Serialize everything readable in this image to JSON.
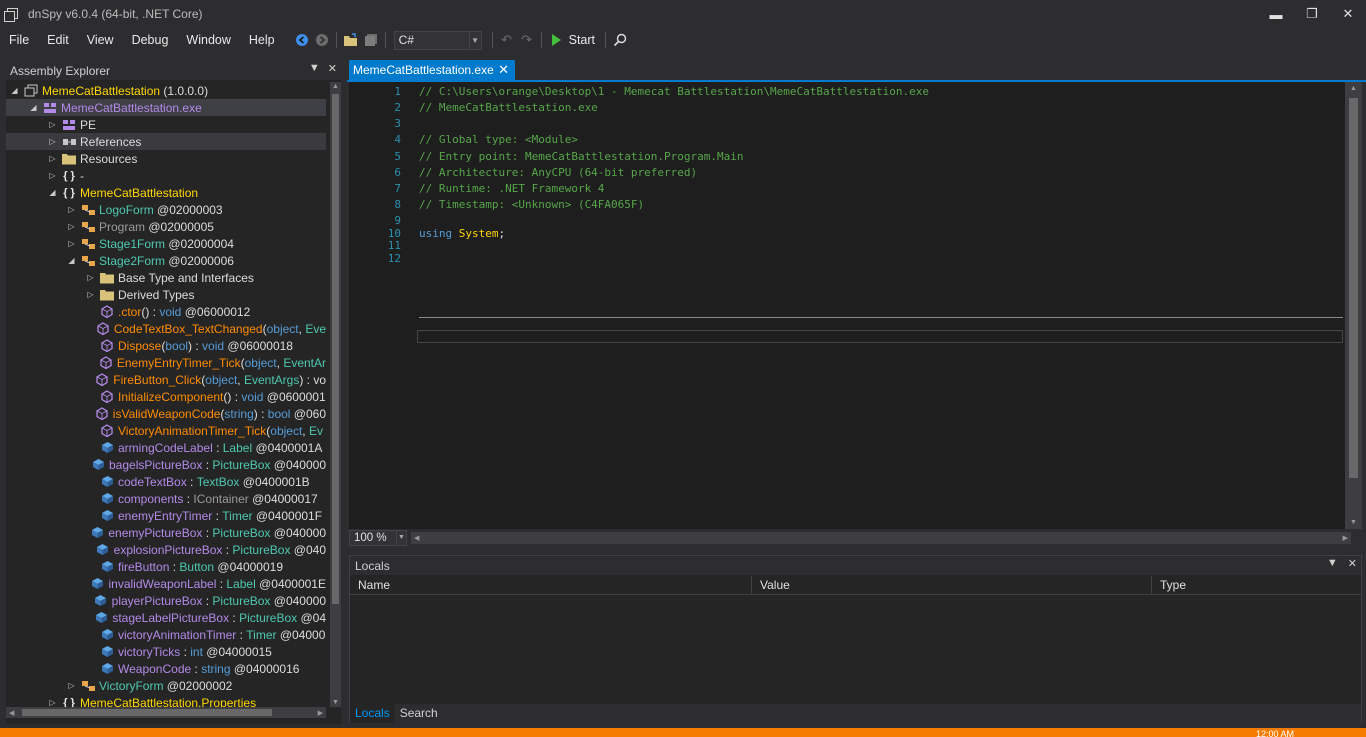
{
  "window": {
    "title": "dnSpy v6.0.4 (64-bit, .NET Core)",
    "minimize": "▬",
    "maximize": "❐",
    "close": "✕"
  },
  "menu": [
    "File",
    "Edit",
    "View",
    "Debug",
    "Window",
    "Help"
  ],
  "toolbar": {
    "language": "C#",
    "start_label": "Start"
  },
  "explorer": {
    "title": "Assembly Explorer",
    "nodes": [
      {
        "indent": 0,
        "exp": "◢",
        "icon": "asm",
        "parts": [
          {
            "t": "MemeCatBattlestation",
            "c": "c-yellow"
          },
          {
            "t": " (1.0.0.0)",
            "c": "c-white"
          }
        ]
      },
      {
        "indent": 1,
        "exp": "◢",
        "icon": "mod",
        "parts": [
          {
            "t": "MemeCatBattlestation.exe",
            "c": "c-purple"
          }
        ],
        "style": "sel"
      },
      {
        "indent": 2,
        "exp": "▷",
        "icon": "mod",
        "parts": [
          {
            "t": "PE",
            "c": "c-white"
          }
        ]
      },
      {
        "indent": 2,
        "exp": "▷",
        "icon": "ref",
        "parts": [
          {
            "t": "References",
            "c": "c-white"
          }
        ],
        "style": "hl"
      },
      {
        "indent": 2,
        "exp": "▷",
        "icon": "folder",
        "parts": [
          {
            "t": "Resources",
            "c": "c-white"
          }
        ]
      },
      {
        "indent": 2,
        "exp": "▷",
        "icon": "ns",
        "parts": [
          {
            "t": "-",
            "c": "c-white"
          }
        ]
      },
      {
        "indent": 2,
        "exp": "◢",
        "icon": "ns",
        "parts": [
          {
            "t": "MemeCatBattlestation",
            "c": "c-yellow"
          }
        ]
      },
      {
        "indent": 3,
        "exp": "▷",
        "icon": "cls",
        "parts": [
          {
            "t": "LogoForm",
            "c": "c-cyan"
          },
          {
            "t": " @02000003",
            "c": "c-white"
          }
        ]
      },
      {
        "indent": 3,
        "exp": "▷",
        "icon": "cls",
        "parts": [
          {
            "t": "Program",
            "c": "c-gray"
          },
          {
            "t": " @02000005",
            "c": "c-white"
          }
        ]
      },
      {
        "indent": 3,
        "exp": "▷",
        "icon": "cls",
        "parts": [
          {
            "t": "Stage1Form",
            "c": "c-cyan"
          },
          {
            "t": " @02000004",
            "c": "c-white"
          }
        ]
      },
      {
        "indent": 3,
        "exp": "◢",
        "icon": "cls",
        "parts": [
          {
            "t": "Stage2Form",
            "c": "c-cyan"
          },
          {
            "t": " @02000006",
            "c": "c-white"
          }
        ]
      },
      {
        "indent": 4,
        "exp": "▷",
        "icon": "folder",
        "parts": [
          {
            "t": "Base Type and Interfaces",
            "c": "c-white"
          }
        ]
      },
      {
        "indent": 4,
        "exp": "▷",
        "icon": "folder",
        "parts": [
          {
            "t": "Derived Types",
            "c": "c-white"
          }
        ]
      },
      {
        "indent": 4,
        "exp": "",
        "icon": "meth",
        "parts": [
          {
            "t": ".ctor",
            "c": "c-orange"
          },
          {
            "t": "() : ",
            "c": "c-white"
          },
          {
            "t": "void",
            "c": "c-blue"
          },
          {
            "t": " @06000012",
            "c": "c-white"
          }
        ]
      },
      {
        "indent": 4,
        "exp": "",
        "icon": "meth",
        "parts": [
          {
            "t": "CodeTextBox_TextChanged",
            "c": "c-orange"
          },
          {
            "t": "(",
            "c": "c-white"
          },
          {
            "t": "object",
            "c": "c-blue"
          },
          {
            "t": ", ",
            "c": "c-white"
          },
          {
            "t": "Eve",
            "c": "c-green"
          }
        ]
      },
      {
        "indent": 4,
        "exp": "",
        "icon": "meth",
        "parts": [
          {
            "t": "Dispose",
            "c": "c-orange"
          },
          {
            "t": "(",
            "c": "c-white"
          },
          {
            "t": "bool",
            "c": "c-blue"
          },
          {
            "t": ") : ",
            "c": "c-white"
          },
          {
            "t": "void",
            "c": "c-blue"
          },
          {
            "t": " @06000018",
            "c": "c-white"
          }
        ]
      },
      {
        "indent": 4,
        "exp": "",
        "icon": "meth",
        "parts": [
          {
            "t": "EnemyEntryTimer_Tick",
            "c": "c-orange"
          },
          {
            "t": "(",
            "c": "c-white"
          },
          {
            "t": "object",
            "c": "c-blue"
          },
          {
            "t": ", ",
            "c": "c-white"
          },
          {
            "t": "EventAr",
            "c": "c-green"
          }
        ]
      },
      {
        "indent": 4,
        "exp": "",
        "icon": "meth",
        "parts": [
          {
            "t": "FireButton_Click",
            "c": "c-orange"
          },
          {
            "t": "(",
            "c": "c-white"
          },
          {
            "t": "object",
            "c": "c-blue"
          },
          {
            "t": ", ",
            "c": "c-white"
          },
          {
            "t": "EventArgs",
            "c": "c-green"
          },
          {
            "t": ") : vo",
            "c": "c-white"
          }
        ]
      },
      {
        "indent": 4,
        "exp": "",
        "icon": "meth",
        "parts": [
          {
            "t": "InitializeComponent",
            "c": "c-orange"
          },
          {
            "t": "() : ",
            "c": "c-white"
          },
          {
            "t": "void",
            "c": "c-blue"
          },
          {
            "t": " @0600001",
            "c": "c-white"
          }
        ]
      },
      {
        "indent": 4,
        "exp": "",
        "icon": "meth",
        "parts": [
          {
            "t": "isValidWeaponCode",
            "c": "c-orange"
          },
          {
            "t": "(",
            "c": "c-white"
          },
          {
            "t": "string",
            "c": "c-blue"
          },
          {
            "t": ") : ",
            "c": "c-white"
          },
          {
            "t": "bool",
            "c": "c-blue"
          },
          {
            "t": " @060",
            "c": "c-white"
          }
        ]
      },
      {
        "indent": 4,
        "exp": "",
        "icon": "meth",
        "parts": [
          {
            "t": "VictoryAnimationTimer_Tick",
            "c": "c-orange"
          },
          {
            "t": "(",
            "c": "c-white"
          },
          {
            "t": "object",
            "c": "c-blue"
          },
          {
            "t": ", ",
            "c": "c-white"
          },
          {
            "t": "Ev",
            "c": "c-green"
          }
        ]
      },
      {
        "indent": 4,
        "exp": "",
        "icon": "fld",
        "parts": [
          {
            "t": "armingCodeLabel",
            "c": "c-purple"
          },
          {
            "t": " : ",
            "c": "c-white"
          },
          {
            "t": "Label",
            "c": "c-green"
          },
          {
            "t": " @0400001A",
            "c": "c-white"
          }
        ]
      },
      {
        "indent": 4,
        "exp": "",
        "icon": "fld",
        "parts": [
          {
            "t": "bagelsPictureBox",
            "c": "c-purple"
          },
          {
            "t": " : ",
            "c": "c-white"
          },
          {
            "t": "PictureBox",
            "c": "c-green"
          },
          {
            "t": " @040000",
            "c": "c-white"
          }
        ]
      },
      {
        "indent": 4,
        "exp": "",
        "icon": "fld",
        "parts": [
          {
            "t": "codeTextBox",
            "c": "c-purple"
          },
          {
            "t": " : ",
            "c": "c-white"
          },
          {
            "t": "TextBox",
            "c": "c-green"
          },
          {
            "t": " @0400001B",
            "c": "c-white"
          }
        ]
      },
      {
        "indent": 4,
        "exp": "",
        "icon": "fld",
        "parts": [
          {
            "t": "components",
            "c": "c-purple"
          },
          {
            "t": " : ",
            "c": "c-white"
          },
          {
            "t": "IContainer",
            "c": "c-gray"
          },
          {
            "t": " @04000017",
            "c": "c-white"
          }
        ]
      },
      {
        "indent": 4,
        "exp": "",
        "icon": "fld",
        "parts": [
          {
            "t": "enemyEntryTimer",
            "c": "c-purple"
          },
          {
            "t": " : ",
            "c": "c-white"
          },
          {
            "t": "Timer",
            "c": "c-green"
          },
          {
            "t": " @0400001F",
            "c": "c-white"
          }
        ]
      },
      {
        "indent": 4,
        "exp": "",
        "icon": "fld",
        "parts": [
          {
            "t": "enemyPictureBox",
            "c": "c-purple"
          },
          {
            "t": " : ",
            "c": "c-white"
          },
          {
            "t": "PictureBox",
            "c": "c-green"
          },
          {
            "t": " @040000",
            "c": "c-white"
          }
        ]
      },
      {
        "indent": 4,
        "exp": "",
        "icon": "fld",
        "parts": [
          {
            "t": "explosionPictureBox",
            "c": "c-purple"
          },
          {
            "t": " : ",
            "c": "c-white"
          },
          {
            "t": "PictureBox",
            "c": "c-green"
          },
          {
            "t": " @040",
            "c": "c-white"
          }
        ]
      },
      {
        "indent": 4,
        "exp": "",
        "icon": "fld",
        "parts": [
          {
            "t": "fireButton",
            "c": "c-purple"
          },
          {
            "t": " : ",
            "c": "c-white"
          },
          {
            "t": "Button",
            "c": "c-green"
          },
          {
            "t": " @04000019",
            "c": "c-white"
          }
        ]
      },
      {
        "indent": 4,
        "exp": "",
        "icon": "fld",
        "parts": [
          {
            "t": "invalidWeaponLabel",
            "c": "c-purple"
          },
          {
            "t": " : ",
            "c": "c-white"
          },
          {
            "t": "Label",
            "c": "c-green"
          },
          {
            "t": " @0400001E",
            "c": "c-white"
          }
        ]
      },
      {
        "indent": 4,
        "exp": "",
        "icon": "fld",
        "parts": [
          {
            "t": "playerPictureBox",
            "c": "c-purple"
          },
          {
            "t": " : ",
            "c": "c-white"
          },
          {
            "t": "PictureBox",
            "c": "c-green"
          },
          {
            "t": " @040000",
            "c": "c-white"
          }
        ]
      },
      {
        "indent": 4,
        "exp": "",
        "icon": "fld",
        "parts": [
          {
            "t": "stageLabelPictureBox",
            "c": "c-purple"
          },
          {
            "t": " : ",
            "c": "c-white"
          },
          {
            "t": "PictureBox",
            "c": "c-green"
          },
          {
            "t": " @04",
            "c": "c-white"
          }
        ]
      },
      {
        "indent": 4,
        "exp": "",
        "icon": "fld",
        "parts": [
          {
            "t": "victoryAnimationTimer",
            "c": "c-purple"
          },
          {
            "t": " : ",
            "c": "c-white"
          },
          {
            "t": "Timer",
            "c": "c-green"
          },
          {
            "t": " @04000",
            "c": "c-white"
          }
        ]
      },
      {
        "indent": 4,
        "exp": "",
        "icon": "fld",
        "parts": [
          {
            "t": "victoryTicks",
            "c": "c-purple"
          },
          {
            "t": " : ",
            "c": "c-white"
          },
          {
            "t": "int",
            "c": "c-blue"
          },
          {
            "t": " @04000015",
            "c": "c-white"
          }
        ]
      },
      {
        "indent": 4,
        "exp": "",
        "icon": "fld",
        "parts": [
          {
            "t": "WeaponCode",
            "c": "c-purple"
          },
          {
            "t": " : ",
            "c": "c-white"
          },
          {
            "t": "string",
            "c": "c-blue"
          },
          {
            "t": " @04000016",
            "c": "c-white"
          }
        ]
      },
      {
        "indent": 3,
        "exp": "▷",
        "icon": "cls",
        "parts": [
          {
            "t": "VictoryForm",
            "c": "c-cyan"
          },
          {
            "t": " @02000002",
            "c": "c-white"
          }
        ]
      },
      {
        "indent": 2,
        "exp": "▷",
        "icon": "ns",
        "parts": [
          {
            "t": "MemeCatBattlestation.Properties",
            "c": "c-yellow"
          }
        ]
      }
    ]
  },
  "editor": {
    "tab_label": "MemeCatBattlestation.exe",
    "line_numbers": [
      "1",
      "2",
      "3",
      "4",
      "5",
      "6",
      "7",
      "8",
      "9",
      "10",
      "11",
      "12"
    ],
    "lines": [
      "// C:\\Users\\orange\\Desktop\\1 - Memecat Battlestation\\MemeCatBattlestation.exe",
      "// MemeCatBattlestation.exe",
      "",
      "// Global type: <Module>",
      "// Entry point: MemeCatBattlestation.Program.Main",
      "// Architecture: AnyCPU (64-bit preferred)",
      "// Runtime: .NET Framework 4",
      "// Timestamp: <Unknown> (C4FA065F)",
      "",
      "",
      "",
      ""
    ],
    "using_keyword": "using",
    "using_ns": "System",
    "using_semicolon": ";",
    "zoom": "100 %"
  },
  "locals": {
    "title": "Locals",
    "columns": [
      "Name",
      "Value",
      "Type"
    ],
    "tabs": [
      "Locals",
      "Search"
    ]
  },
  "taskbar": {
    "clock": "12:00 AM"
  }
}
